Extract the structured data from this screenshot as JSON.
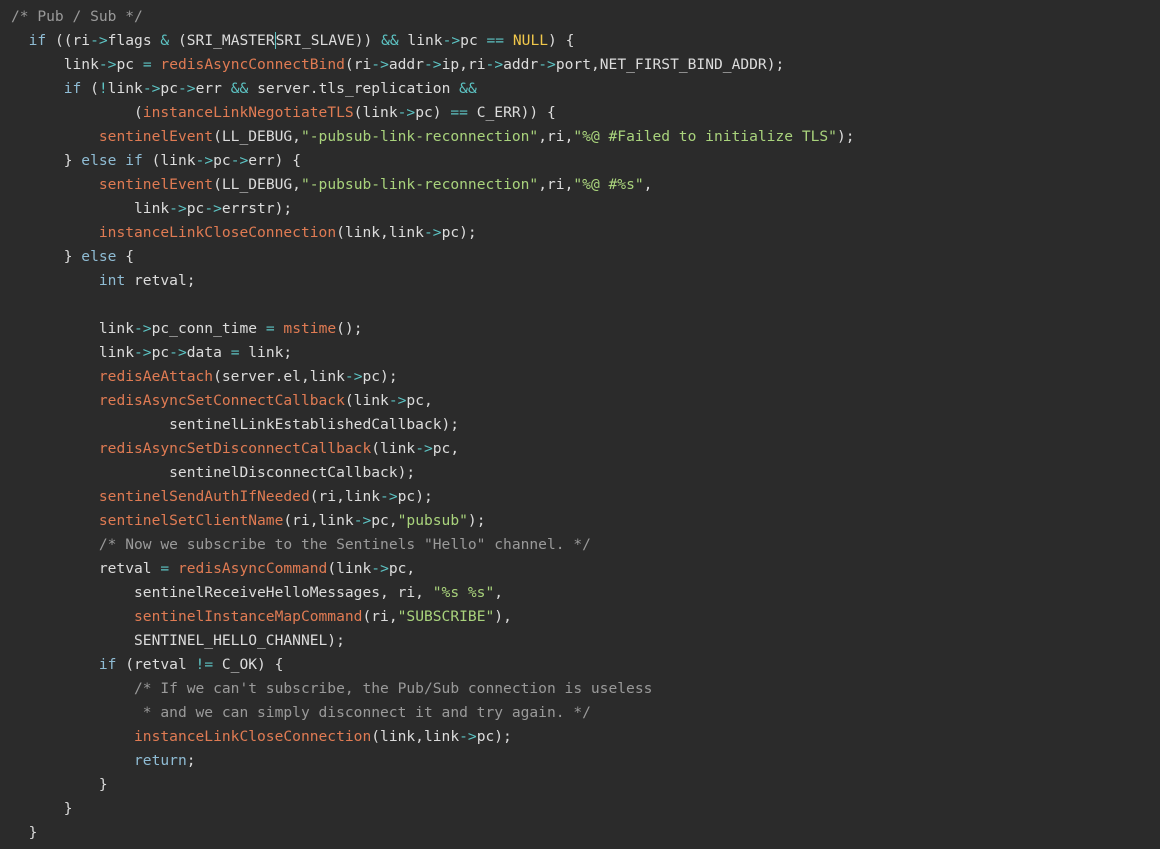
{
  "editor": {
    "colors": {
      "background": "#2b2b2b",
      "plain": "#dcdcdc",
      "keyword": "#8fbcd4",
      "function": "#e07b53",
      "operator": "#5dc4c4",
      "string": "#a9d37c",
      "constant": "#f1c84b",
      "comment": "#9a9a9a"
    },
    "lines": [
      [
        [
          "comment",
          "/* Pub / Sub */"
        ]
      ],
      [
        [
          "plain",
          "  "
        ],
        [
          "keyword",
          "if"
        ],
        [
          "plain",
          " ((ri"
        ],
        [
          "op",
          "->"
        ],
        [
          "plain",
          "flags "
        ],
        [
          "op",
          "&"
        ],
        [
          "plain",
          " (SRI_MASTER"
        ],
        [
          "cursor",
          "SRI_SLAVE)) "
        ],
        [
          "op",
          "&&"
        ],
        [
          "plain",
          " link"
        ],
        [
          "op",
          "->"
        ],
        [
          "plain",
          "pc "
        ],
        [
          "op",
          "=="
        ],
        [
          "plain",
          " "
        ],
        [
          "const",
          "NULL"
        ],
        [
          "plain",
          ") {"
        ]
      ],
      [
        [
          "plain",
          "      link"
        ],
        [
          "op",
          "->"
        ],
        [
          "plain",
          "pc "
        ],
        [
          "op",
          "="
        ],
        [
          "plain",
          " "
        ],
        [
          "func",
          "redisAsyncConnectBind"
        ],
        [
          "plain",
          "(ri"
        ],
        [
          "op",
          "->"
        ],
        [
          "plain",
          "addr"
        ],
        [
          "op",
          "->"
        ],
        [
          "plain",
          "ip,ri"
        ],
        [
          "op",
          "->"
        ],
        [
          "plain",
          "addr"
        ],
        [
          "op",
          "->"
        ],
        [
          "plain",
          "port,NET_FIRST_BIND_ADDR);"
        ]
      ],
      [
        [
          "plain",
          "      "
        ],
        [
          "keyword",
          "if"
        ],
        [
          "plain",
          " ("
        ],
        [
          "op",
          "!"
        ],
        [
          "plain",
          "link"
        ],
        [
          "op",
          "->"
        ],
        [
          "plain",
          "pc"
        ],
        [
          "op",
          "->"
        ],
        [
          "plain",
          "err "
        ],
        [
          "op",
          "&&"
        ],
        [
          "plain",
          " server.tls_replication "
        ],
        [
          "op",
          "&&"
        ]
      ],
      [
        [
          "plain",
          "              ("
        ],
        [
          "func",
          "instanceLinkNegotiateTLS"
        ],
        [
          "plain",
          "(link"
        ],
        [
          "op",
          "->"
        ],
        [
          "plain",
          "pc) "
        ],
        [
          "op",
          "=="
        ],
        [
          "plain",
          " C_ERR)) {"
        ]
      ],
      [
        [
          "plain",
          "          "
        ],
        [
          "func",
          "sentinelEvent"
        ],
        [
          "plain",
          "(LL_DEBUG,"
        ],
        [
          "string",
          "\"-pubsub-link-reconnection\""
        ],
        [
          "plain",
          ",ri,"
        ],
        [
          "string",
          "\"%@ #Failed to initialize TLS\""
        ],
        [
          "plain",
          ");"
        ]
      ],
      [
        [
          "plain",
          "      } "
        ],
        [
          "keyword",
          "else"
        ],
        [
          "plain",
          " "
        ],
        [
          "keyword",
          "if"
        ],
        [
          "plain",
          " (link"
        ],
        [
          "op",
          "->"
        ],
        [
          "plain",
          "pc"
        ],
        [
          "op",
          "->"
        ],
        [
          "plain",
          "err) {"
        ]
      ],
      [
        [
          "plain",
          "          "
        ],
        [
          "func",
          "sentinelEvent"
        ],
        [
          "plain",
          "(LL_DEBUG,"
        ],
        [
          "string",
          "\"-pubsub-link-reconnection\""
        ],
        [
          "plain",
          ",ri,"
        ],
        [
          "string",
          "\"%@ #%s\""
        ],
        [
          "plain",
          ","
        ]
      ],
      [
        [
          "plain",
          "              link"
        ],
        [
          "op",
          "->"
        ],
        [
          "plain",
          "pc"
        ],
        [
          "op",
          "->"
        ],
        [
          "plain",
          "errstr);"
        ]
      ],
      [
        [
          "plain",
          "          "
        ],
        [
          "func",
          "instanceLinkCloseConnection"
        ],
        [
          "plain",
          "(link,link"
        ],
        [
          "op",
          "->"
        ],
        [
          "plain",
          "pc);"
        ]
      ],
      [
        [
          "plain",
          "      } "
        ],
        [
          "keyword",
          "else"
        ],
        [
          "plain",
          " {"
        ]
      ],
      [
        [
          "plain",
          "          "
        ],
        [
          "type",
          "int"
        ],
        [
          "plain",
          " retval;"
        ]
      ],
      [
        [
          "plain",
          ""
        ]
      ],
      [
        [
          "plain",
          "          link"
        ],
        [
          "op",
          "->"
        ],
        [
          "plain",
          "pc_conn_time "
        ],
        [
          "op",
          "="
        ],
        [
          "plain",
          " "
        ],
        [
          "func",
          "mstime"
        ],
        [
          "plain",
          "();"
        ]
      ],
      [
        [
          "plain",
          "          link"
        ],
        [
          "op",
          "->"
        ],
        [
          "plain",
          "pc"
        ],
        [
          "op",
          "->"
        ],
        [
          "plain",
          "data "
        ],
        [
          "op",
          "="
        ],
        [
          "plain",
          " link;"
        ]
      ],
      [
        [
          "plain",
          "          "
        ],
        [
          "func",
          "redisAeAttach"
        ],
        [
          "plain",
          "(server.el,link"
        ],
        [
          "op",
          "->"
        ],
        [
          "plain",
          "pc);"
        ]
      ],
      [
        [
          "plain",
          "          "
        ],
        [
          "func",
          "redisAsyncSetConnectCallback"
        ],
        [
          "plain",
          "(link"
        ],
        [
          "op",
          "->"
        ],
        [
          "plain",
          "pc,"
        ]
      ],
      [
        [
          "plain",
          "                  sentinelLinkEstablishedCallback);"
        ]
      ],
      [
        [
          "plain",
          "          "
        ],
        [
          "func",
          "redisAsyncSetDisconnectCallback"
        ],
        [
          "plain",
          "(link"
        ],
        [
          "op",
          "->"
        ],
        [
          "plain",
          "pc,"
        ]
      ],
      [
        [
          "plain",
          "                  sentinelDisconnectCallback);"
        ]
      ],
      [
        [
          "plain",
          "          "
        ],
        [
          "func",
          "sentinelSendAuthIfNeeded"
        ],
        [
          "plain",
          "(ri,link"
        ],
        [
          "op",
          "->"
        ],
        [
          "plain",
          "pc);"
        ]
      ],
      [
        [
          "plain",
          "          "
        ],
        [
          "func",
          "sentinelSetClientName"
        ],
        [
          "plain",
          "(ri,link"
        ],
        [
          "op",
          "->"
        ],
        [
          "plain",
          "pc,"
        ],
        [
          "string",
          "\"pubsub\""
        ],
        [
          "plain",
          ");"
        ]
      ],
      [
        [
          "plain",
          "          "
        ],
        [
          "comment",
          "/* Now we subscribe to the Sentinels \"Hello\" channel. */"
        ]
      ],
      [
        [
          "plain",
          "          retval "
        ],
        [
          "op",
          "="
        ],
        [
          "plain",
          " "
        ],
        [
          "func",
          "redisAsyncCommand"
        ],
        [
          "plain",
          "(link"
        ],
        [
          "op",
          "->"
        ],
        [
          "plain",
          "pc,"
        ]
      ],
      [
        [
          "plain",
          "              sentinelReceiveHelloMessages, ri, "
        ],
        [
          "string",
          "\"%s %s\""
        ],
        [
          "plain",
          ","
        ]
      ],
      [
        [
          "plain",
          "              "
        ],
        [
          "func",
          "sentinelInstanceMapCommand"
        ],
        [
          "plain",
          "(ri,"
        ],
        [
          "string",
          "\"SUBSCRIBE\""
        ],
        [
          "plain",
          "),"
        ]
      ],
      [
        [
          "plain",
          "              SENTINEL_HELLO_CHANNEL);"
        ]
      ],
      [
        [
          "plain",
          "          "
        ],
        [
          "keyword",
          "if"
        ],
        [
          "plain",
          " (retval "
        ],
        [
          "op",
          "!="
        ],
        [
          "plain",
          " C_OK) {"
        ]
      ],
      [
        [
          "plain",
          "              "
        ],
        [
          "comment",
          "/* If we can't subscribe, the Pub/Sub connection is useless"
        ]
      ],
      [
        [
          "plain",
          "               "
        ],
        [
          "comment",
          "* and we can simply disconnect it and try again. */"
        ]
      ],
      [
        [
          "plain",
          "              "
        ],
        [
          "func",
          "instanceLinkCloseConnection"
        ],
        [
          "plain",
          "(link,link"
        ],
        [
          "op",
          "->"
        ],
        [
          "plain",
          "pc);"
        ]
      ],
      [
        [
          "plain",
          "              "
        ],
        [
          "keyword",
          "return"
        ],
        [
          "plain",
          ";"
        ]
      ],
      [
        [
          "plain",
          "          }"
        ]
      ],
      [
        [
          "plain",
          "      }"
        ]
      ],
      [
        [
          "plain",
          "  }"
        ]
      ]
    ]
  }
}
